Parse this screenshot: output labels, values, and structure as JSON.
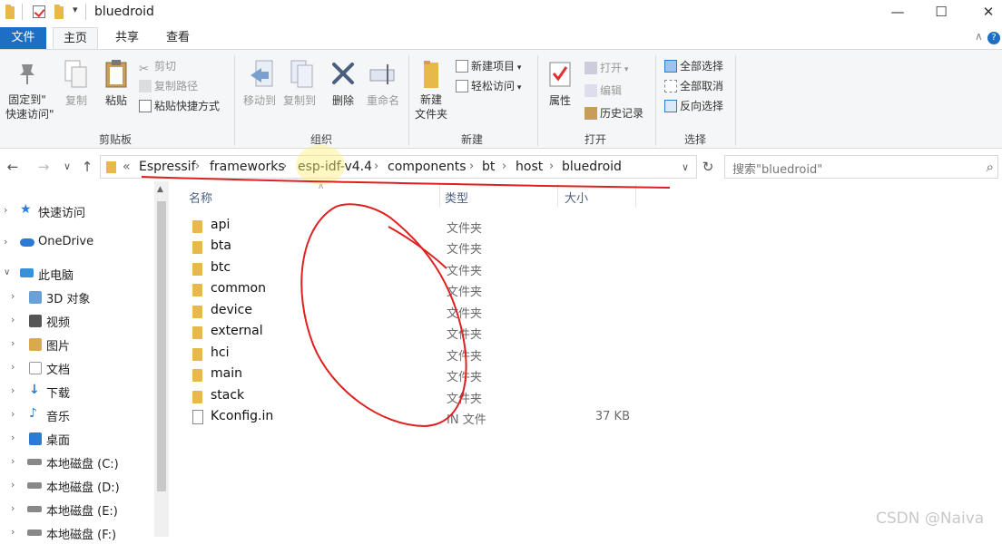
{
  "window": {
    "title": "bluedroid",
    "qa_arrow": "▾",
    "minimize": "—",
    "maximize": "☐",
    "close": "✕"
  },
  "tabs": [
    "文件",
    "主页",
    "共享",
    "查看"
  ],
  "ribbon_collapse": "∧",
  "help": "?",
  "ribbon": {
    "clipboard": {
      "label": "剪贴板",
      "pin": "固定到\"\n快速访问\"",
      "pin_l1": "固定到\"",
      "pin_l2": "快速访问\"",
      "copy": "复制",
      "paste": "粘贴",
      "cut": "剪切",
      "copy_path": "复制路径",
      "paste_shortcut": "粘贴快捷方式"
    },
    "organize": {
      "label": "组织",
      "move_to": "移动到",
      "copy_to": "复制到",
      "delete": "删除",
      "rename": "重命名"
    },
    "new": {
      "label": "新建",
      "new_folder_l1": "新建",
      "new_folder_l2": "文件夹",
      "new_item": "新建项目",
      "easy_access": "轻松访问"
    },
    "open": {
      "label": "打开",
      "properties": "属性",
      "open": "打开",
      "edit": "编辑",
      "history": "历史记录"
    },
    "select": {
      "label": "选择",
      "select_all": "全部选择",
      "select_none": "全部取消",
      "invert": "反向选择"
    }
  },
  "nav": {
    "back": "←",
    "forward": "→",
    "recent": "∨",
    "up": "↑",
    "overflow": "«",
    "breadcrumb": [
      "Espressif",
      "frameworks",
      "esp-idf-v4.4",
      "components",
      "bt",
      "host",
      "bluedroid"
    ],
    "dropdown": "∨",
    "refresh": "↻",
    "search_placeholder": "搜索\"bluedroid\"",
    "search_icon": "⌕"
  },
  "sidebar": {
    "items": [
      {
        "label": "快速访问",
        "icon": "star-icon",
        "color": "#2b7bd6"
      },
      {
        "label": "OneDrive",
        "icon": "cloud-icon",
        "color": "#2b7bd6"
      },
      {
        "label": "此电脑",
        "icon": "computer-icon",
        "color": "#3a8fd9"
      },
      {
        "label": "3D 对象",
        "icon": "cube-icon",
        "color": "#6aa0d8"
      },
      {
        "label": "视频",
        "icon": "film-icon",
        "color": "#555555"
      },
      {
        "label": "图片",
        "icon": "picture-icon",
        "color": "#d9a94a"
      },
      {
        "label": "文档",
        "icon": "document-icon",
        "color": "#9a9a9a"
      },
      {
        "label": "下载",
        "icon": "download-icon",
        "color": "#2b7bd6"
      },
      {
        "label": "音乐",
        "icon": "music-icon",
        "color": "#2b7bd6"
      },
      {
        "label": "桌面",
        "icon": "desktop-icon",
        "color": "#2b7bd6"
      },
      {
        "label": "本地磁盘 (C:)",
        "icon": "drive-icon",
        "color": "#888888"
      },
      {
        "label": "本地磁盘 (D:)",
        "icon": "drive-icon",
        "color": "#888888"
      },
      {
        "label": "本地磁盘 (E:)",
        "icon": "drive-icon",
        "color": "#888888"
      },
      {
        "label": "本地磁盘 (F:)",
        "icon": "drive-icon",
        "color": "#888888"
      }
    ]
  },
  "filelist": {
    "columns": {
      "name": "名称",
      "type": "类型",
      "size": "大小"
    },
    "sort_arrow": "∧",
    "rows": [
      {
        "name": "api",
        "type": "文件夹",
        "size": "",
        "kind": "folder"
      },
      {
        "name": "bta",
        "type": "文件夹",
        "size": "",
        "kind": "folder"
      },
      {
        "name": "btc",
        "type": "文件夹",
        "size": "",
        "kind": "folder"
      },
      {
        "name": "common",
        "type": "文件夹",
        "size": "",
        "kind": "folder"
      },
      {
        "name": "device",
        "type": "文件夹",
        "size": "",
        "kind": "folder"
      },
      {
        "name": "external",
        "type": "文件夹",
        "size": "",
        "kind": "folder"
      },
      {
        "name": "hci",
        "type": "文件夹",
        "size": "",
        "kind": "folder"
      },
      {
        "name": "main",
        "type": "文件夹",
        "size": "",
        "kind": "folder"
      },
      {
        "name": "stack",
        "type": "文件夹",
        "size": "",
        "kind": "folder"
      },
      {
        "name": "Kconfig.in",
        "type": "IN 文件",
        "size": "37 KB",
        "kind": "file"
      }
    ]
  },
  "watermark": "CSDN @Naiva",
  "annotation_color": "#e02020",
  "accent": "#1e6fc4"
}
